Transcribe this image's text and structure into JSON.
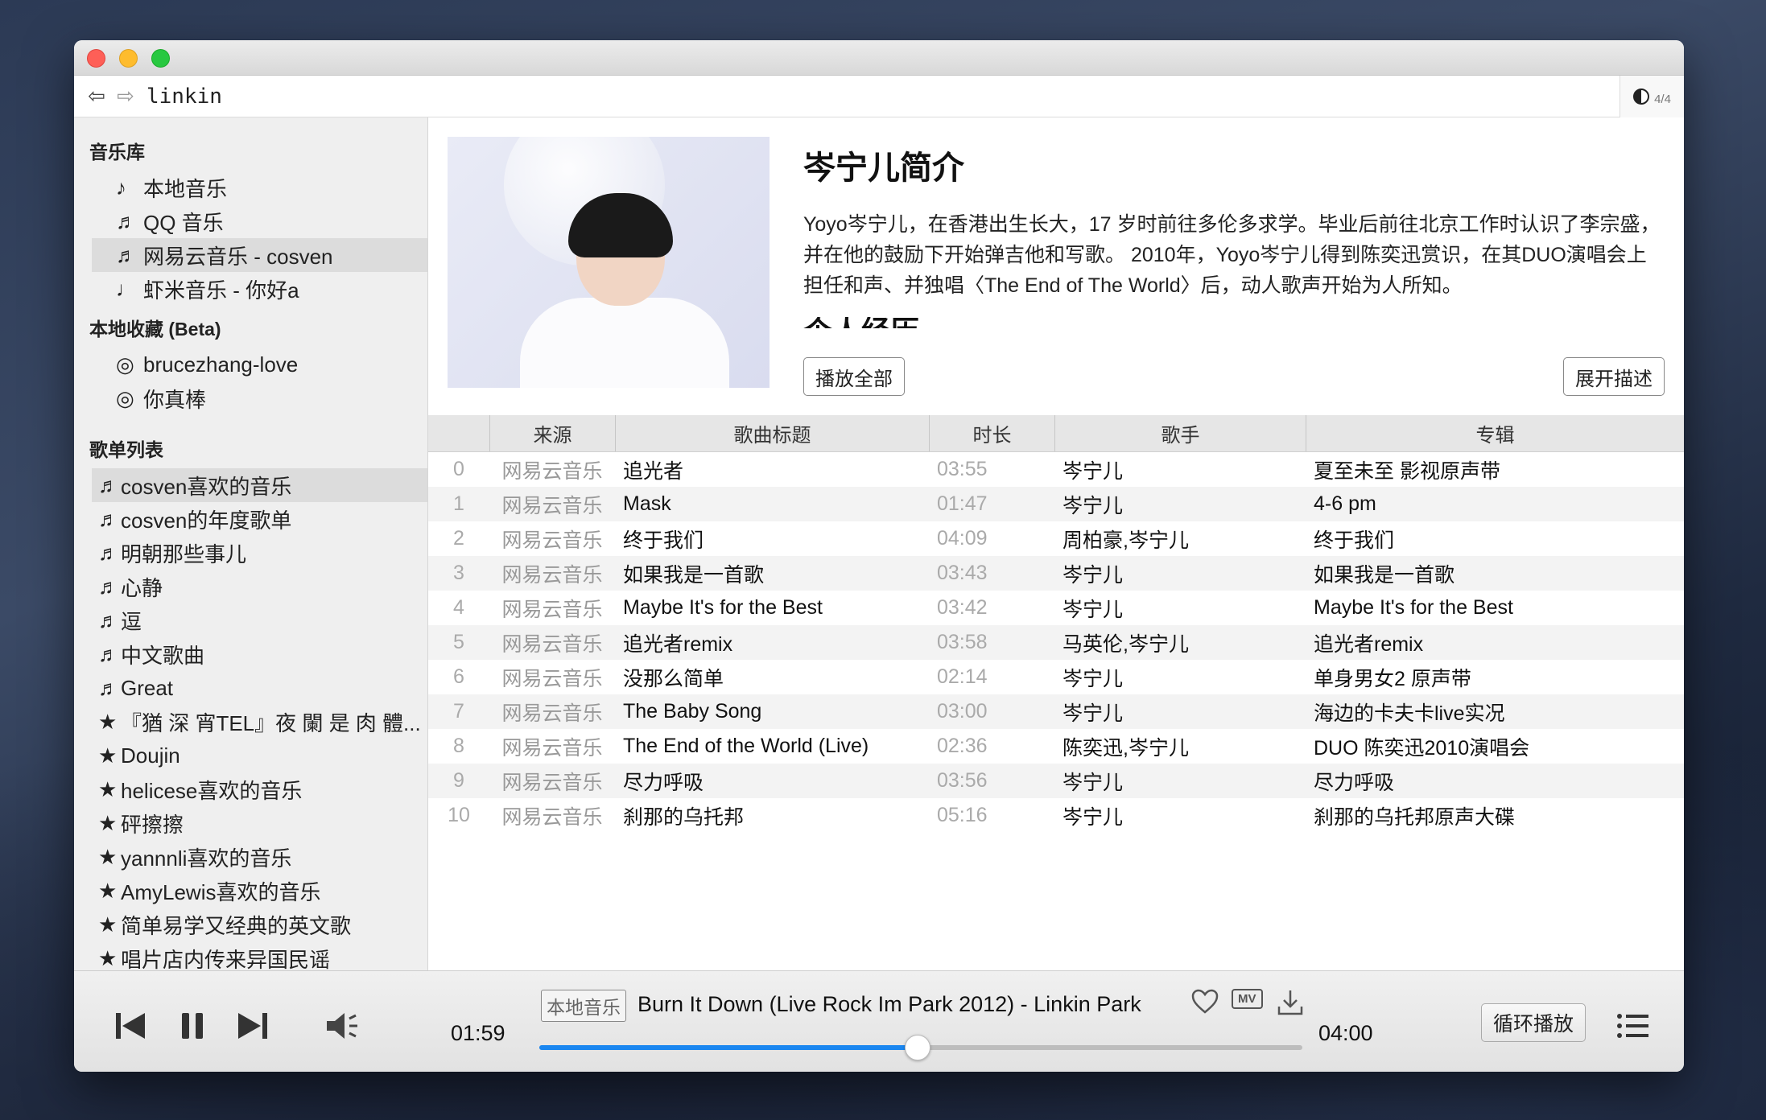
{
  "toolbar": {
    "back_icon": "arrow-left-icon",
    "forward_icon": "arrow-right-icon",
    "search_value": "linkin",
    "page_count": "4/4"
  },
  "sidebar": {
    "library_title": "音乐库",
    "library": [
      {
        "icon": "♪",
        "label": "本地音乐"
      },
      {
        "icon": "♬",
        "label": "QQ 音乐"
      },
      {
        "icon": "♬",
        "label": "网易云音乐 - cosven"
      },
      {
        "icon": "♩",
        "label": "虾米音乐 - 你好a"
      }
    ],
    "favorites_title": "本地收藏 (Beta)",
    "favorites": [
      {
        "icon": "◎",
        "label": "brucezhang-love"
      },
      {
        "icon": "◎",
        "label": "你真棒"
      }
    ],
    "playlists_title": "歌单列表",
    "playlists": [
      {
        "icon": "♬",
        "label": "cosven喜欢的音乐"
      },
      {
        "icon": "♬",
        "label": "cosven的年度歌单"
      },
      {
        "icon": "♬",
        "label": "明朝那些事儿"
      },
      {
        "icon": "♬",
        "label": "心静"
      },
      {
        "icon": "♬",
        "label": "逗"
      },
      {
        "icon": "♬",
        "label": "中文歌曲"
      },
      {
        "icon": "♬",
        "label": "Great"
      },
      {
        "icon": "★",
        "label": "『猶 深 宵TEL』夜 闌 是 肉 體..."
      },
      {
        "icon": "★",
        "label": "Doujin"
      },
      {
        "icon": "★",
        "label": "helicese喜欢的音乐"
      },
      {
        "icon": "★",
        "label": "砰擦擦"
      },
      {
        "icon": "★",
        "label": "yannnli喜欢的音乐"
      },
      {
        "icon": "★",
        "label": "AmyLewis喜欢的音乐"
      },
      {
        "icon": "★",
        "label": "简单易学又经典的英文歌"
      },
      {
        "icon": "★",
        "label": "唱片店内传来异国民谣"
      }
    ]
  },
  "artist": {
    "title": "岑宁儿简介",
    "description": "Yoyo岑宁儿，在香港出生长大，17 岁时前往多伦多求学。毕业后前往北京工作时认识了李宗盛，并在他的鼓励下开始弹吉他和写歌。 2010年，Yoyo岑宁儿得到陈奕迅赏识，在其DUO演唱会上担任和声、并独唱〈The End of The World〉后，动人歌声开始为人所知。",
    "subheading": "个人经历",
    "play_all": "播放全部",
    "expand": "展开描述"
  },
  "table": {
    "headers": [
      "",
      "来源",
      "歌曲标题",
      "时长",
      "歌手",
      "专辑"
    ],
    "rows": [
      {
        "idx": "0",
        "source": "网易云音乐",
        "title": "追光者",
        "duration": "03:55",
        "artist": "岑宁儿",
        "album": "夏至未至 影视原声带"
      },
      {
        "idx": "1",
        "source": "网易云音乐",
        "title": "Mask",
        "duration": "01:47",
        "artist": "岑宁儿",
        "album": "4-6 pm"
      },
      {
        "idx": "2",
        "source": "网易云音乐",
        "title": "终于我们",
        "duration": "04:09",
        "artist": "周柏豪,岑宁儿",
        "album": "终于我们"
      },
      {
        "idx": "3",
        "source": "网易云音乐",
        "title": "如果我是一首歌",
        "duration": "03:43",
        "artist": "岑宁儿",
        "album": "如果我是一首歌"
      },
      {
        "idx": "4",
        "source": "网易云音乐",
        "title": "Maybe It's for the Best",
        "duration": "03:42",
        "artist": "岑宁儿",
        "album": "Maybe It's for the Best"
      },
      {
        "idx": "5",
        "source": "网易云音乐",
        "title": "追光者remix",
        "duration": "03:58",
        "artist": "马英伦,岑宁儿",
        "album": "追光者remix"
      },
      {
        "idx": "6",
        "source": "网易云音乐",
        "title": "没那么简单",
        "duration": "02:14",
        "artist": "岑宁儿",
        "album": "单身男女2 原声带"
      },
      {
        "idx": "7",
        "source": "网易云音乐",
        "title": "The Baby Song",
        "duration": "03:00",
        "artist": "岑宁儿",
        "album": "海边的卡夫卡live实况"
      },
      {
        "idx": "8",
        "source": "网易云音乐",
        "title": "The End of the World (Live)",
        "duration": "02:36",
        "artist": "陈奕迅,岑宁儿",
        "album": "DUO 陈奕迅2010演唱会"
      },
      {
        "idx": "9",
        "source": "网易云音乐",
        "title": "尽力呼吸",
        "duration": "03:56",
        "artist": "岑宁儿",
        "album": "尽力呼吸"
      },
      {
        "idx": "10",
        "source": "网易云音乐",
        "title": "刹那的乌托邦",
        "duration": "05:16",
        "artist": "岑宁儿",
        "album": "刹那的乌托邦原声大碟"
      }
    ]
  },
  "player": {
    "current_time": "01:59",
    "total_time": "04:00",
    "source_tag": "本地音乐",
    "now_playing": "Burn It Down (Live Rock Im Park 2012) - Linkin Park",
    "progress": 0.496,
    "mv_label": "MV",
    "loop_mode": "循环播放",
    "accent_color": "#1a86f0"
  }
}
